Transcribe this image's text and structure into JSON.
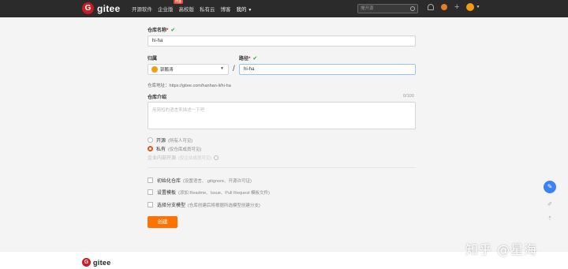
{
  "header": {
    "logo_text": "gitee",
    "nav": [
      {
        "label": "开源软件"
      },
      {
        "label": "企业版",
        "badge": "特惠"
      },
      {
        "label": "高校版"
      },
      {
        "label": "私有云"
      },
      {
        "label": "博客"
      },
      {
        "label": "我的"
      }
    ],
    "search_placeholder": "搜开源"
  },
  "form": {
    "repo_name_label": "仓库名称",
    "repo_name_value": "hi-ha",
    "owner_label": "归属",
    "owner_value": "郭鹏涛",
    "path_label": "路径",
    "path_value": "hi-ha",
    "address_label": "仓库地址：",
    "address_value": "https://gitee.com/hanhan-li/hi-ha",
    "desc_label": "仓库介绍",
    "desc_counter": "0/100",
    "desc_placeholder": "用简短的语言来描述一下吧",
    "visibility": [
      {
        "label": "开源",
        "sub": "(所有人可见)",
        "selected": false
      },
      {
        "label": "私有",
        "sub": "(仅仓库成员可见)",
        "selected": true
      },
      {
        "label": "企业内部开源",
        "sub": "(仅企业成员可见)",
        "selected": false,
        "disabled": true
      }
    ],
    "options": [
      {
        "label": "初始化仓库",
        "sub": "(设置语言、.gitignore、开源许可证)"
      },
      {
        "label": "设置模板",
        "sub": "(添加 Readme、Issue、Pull Request 模板文件)"
      },
      {
        "label": "选择分支模型",
        "sub": "(仓库创建后将根据所选模型创建分支)"
      }
    ],
    "create_label": "创建"
  },
  "footer": {
    "logo_text": "gitee"
  },
  "watermark": "知乎 @星海",
  "colors": {
    "accent": "#fe7300",
    "brand": "#c71d23",
    "valid": "#21a33b"
  }
}
